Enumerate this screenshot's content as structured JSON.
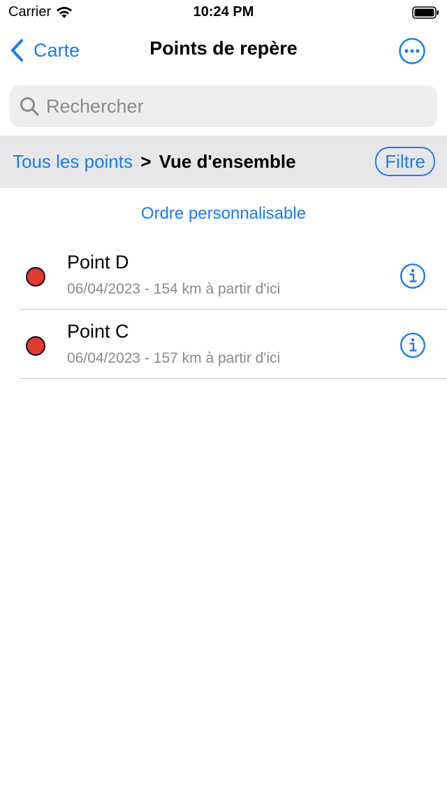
{
  "status_bar": {
    "carrier": "Carrier",
    "time": "10:24 PM",
    "icons": [
      "wifi-icon",
      "battery-icon"
    ]
  },
  "nav": {
    "back_label": "Carte",
    "title": "Points de repère",
    "more_icon": "ellipsis-circle-icon"
  },
  "search": {
    "placeholder": "Rechercher",
    "value": ""
  },
  "breadcrumb": {
    "link": "Tous les points",
    "separator": ">",
    "current": "Vue d'ensemble"
  },
  "filter_label": "Filtre",
  "order_label": "Ordre personnalisable",
  "items": [
    {
      "title": "Point D",
      "subtitle": "06/04/2023 - 154 km à partir d'ici",
      "color": "#e03a32"
    },
    {
      "title": "Point C",
      "subtitle": "06/04/2023 - 157 km à partir d'ici",
      "color": "#e03a32"
    }
  ],
  "colors": {
    "accent": "#1a7cf0",
    "marker": "#e03a32",
    "secondary_text": "#8a8a8e",
    "bar_background": "#e7e7ea"
  }
}
